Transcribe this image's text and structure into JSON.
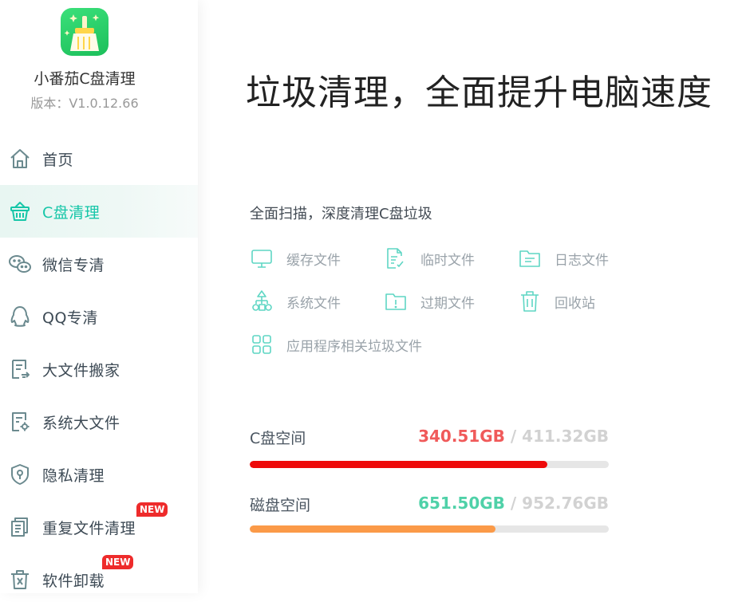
{
  "app": {
    "name": "小番茄C盘清理",
    "version": "版本：V1.0.12.66"
  },
  "sidebar": {
    "items": [
      {
        "label": "首页",
        "icon": "home-icon",
        "active": false
      },
      {
        "label": "C盘清理",
        "icon": "basket-icon",
        "active": true
      },
      {
        "label": "微信专清",
        "icon": "wechat-icon",
        "active": false
      },
      {
        "label": "QQ专清",
        "icon": "qq-icon",
        "active": false
      },
      {
        "label": "大文件搬家",
        "icon": "file-move-icon",
        "active": false
      },
      {
        "label": "系统大文件",
        "icon": "system-file-icon",
        "active": false
      },
      {
        "label": "隐私清理",
        "icon": "shield-icon",
        "active": false
      },
      {
        "label": "重复文件清理",
        "icon": "duplicate-file-icon",
        "active": false,
        "badge": "NEW"
      },
      {
        "label": "软件卸载",
        "icon": "trash-icon",
        "active": false,
        "badge": "NEW"
      }
    ]
  },
  "main": {
    "headline": "垃圾清理，全面提升电脑速度",
    "subtitle": "全面扫描，深度清理C盘垃圾",
    "categories": [
      {
        "label": "缓存文件",
        "icon": "monitor-icon"
      },
      {
        "label": "临时文件",
        "icon": "document-edit-icon"
      },
      {
        "label": "日志文件",
        "icon": "folder-icon"
      },
      {
        "label": "系统文件",
        "icon": "hierarchy-icon"
      },
      {
        "label": "过期文件",
        "icon": "folder-alert-icon"
      },
      {
        "label": "回收站",
        "icon": "recycle-bin-icon"
      },
      {
        "label": "应用程序相关垃圾文件",
        "icon": "apps-grid-icon"
      }
    ],
    "disks": [
      {
        "label": "C盘空间",
        "used": "340.51GB",
        "sep": " / ",
        "total": "411.32GB",
        "used_fraction": 0.828,
        "color": "#ee0a0a",
        "value_color": "#f05a5a"
      },
      {
        "label": "磁盘空间",
        "used": "651.50GB",
        "sep": " / ",
        "total": "952.76GB",
        "used_fraction": 0.684,
        "color": "#fb9a48",
        "value_color": "#4fd1a8"
      }
    ]
  },
  "colors": {
    "accent": "#16c6a8",
    "icon_teal": "#5fd6c4",
    "badge": "#ee2b2b"
  }
}
